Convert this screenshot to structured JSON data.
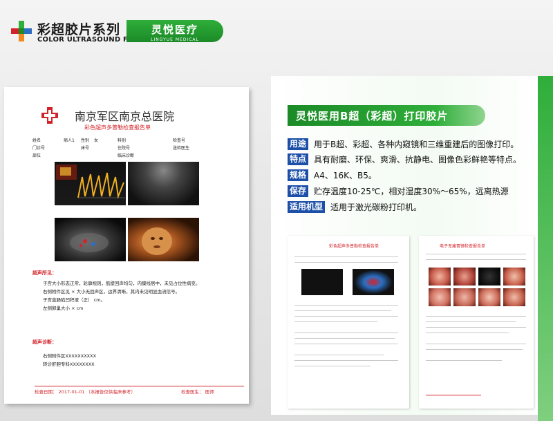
{
  "header": {
    "brand_cn": "彩超胶片系列",
    "brand_en": "COLOR ULTRASOUND FILM",
    "company_cn": "灵悦医疗",
    "company_en": "LINGYUE MEDICAL"
  },
  "report": {
    "hospital": "南京军区南京总医院",
    "subtitle": "彩色超声多普勒检查报告单",
    "meta": {
      "name_label": "姓名",
      "patient_label": "病人1",
      "sex_label": "性别",
      "sex_value": "女",
      "age_label": "科别",
      "bed_label": "检查号",
      "clinic_label": "门诊号",
      "bed_no_label": "床号",
      "dept_label": "住院号",
      "doctor_label": "送检医生",
      "site_label": "部位",
      "diag_label": "临床诊断"
    },
    "findings_title": "超声所见：",
    "findings": [
      "子宫大小形态正常，轮廓规则，肌壁回声均匀，内膜线居中，未见占位性病变。",
      "右侧附件区见  ×  大小无回声区，边界清晰，其内未见明显血流信号。",
      "子宫直肠陷凹积液（正）  cm。",
      "左侧卵巢大小  ×  cm"
    ],
    "diagnosis_title": "超声诊断：",
    "diagnosis": [
      "右侧附件区XXXXXXXXXX",
      "转诊肝胆专科XXXXXXXX"
    ],
    "footer_left": "检查日期：  2017-01-01  （本报告仅供临床参考）",
    "footer_right": "检查医生：  医师"
  },
  "product": {
    "title": "灵悦医用B超（彩超）打印胶片",
    "specs": [
      {
        "tag": "用途",
        "text": "用于B超、彩超、各种内窥镜和三维重建后的图像打印。"
      },
      {
        "tag": "特点",
        "text": "具有耐磨、环保、爽滑、抗静电、图像色彩鲜艳等特点。"
      },
      {
        "tag": "规格",
        "text": "A4、16K、B5。"
      },
      {
        "tag": "保存",
        "text": "贮存温度10-25℃，相对湿度30%～65%，远离热源"
      },
      {
        "tag": "适用机型",
        "text": "适用于激光碳粉打印机。"
      }
    ]
  },
  "samples": {
    "sample1_title": "彩色超声多普勒检查报告单",
    "sample2_title": "电子无痛胃镜检查报告单"
  },
  "colors": {
    "brand_green": "#2fae3a",
    "tag_blue": "#1c4fa8",
    "report_red": "#d2232a"
  }
}
